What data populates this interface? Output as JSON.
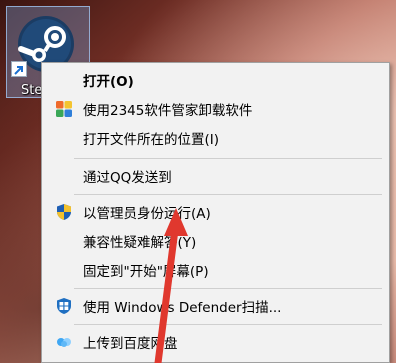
{
  "desktop": {
    "icon_label": "Ste"
  },
  "context_menu": {
    "items": [
      {
        "label": "打开(O)"
      },
      {
        "label": "使用2345软件管家卸载软件"
      },
      {
        "label": "打开文件所在的位置(I)"
      },
      {
        "label": "通过QQ发送到"
      },
      {
        "label": "以管理员身份运行(A)"
      },
      {
        "label": "兼容性疑难解答(Y)"
      },
      {
        "label": "固定到\"开始\"屏幕(P)"
      },
      {
        "label": "使用 Windows Defender扫描..."
      },
      {
        "label": "上传到百度网盘"
      }
    ]
  },
  "colors": {
    "arrow": "#e0382e",
    "uac_shield_blue": "#1f5fb4",
    "uac_shield_yellow": "#f2c12e"
  }
}
